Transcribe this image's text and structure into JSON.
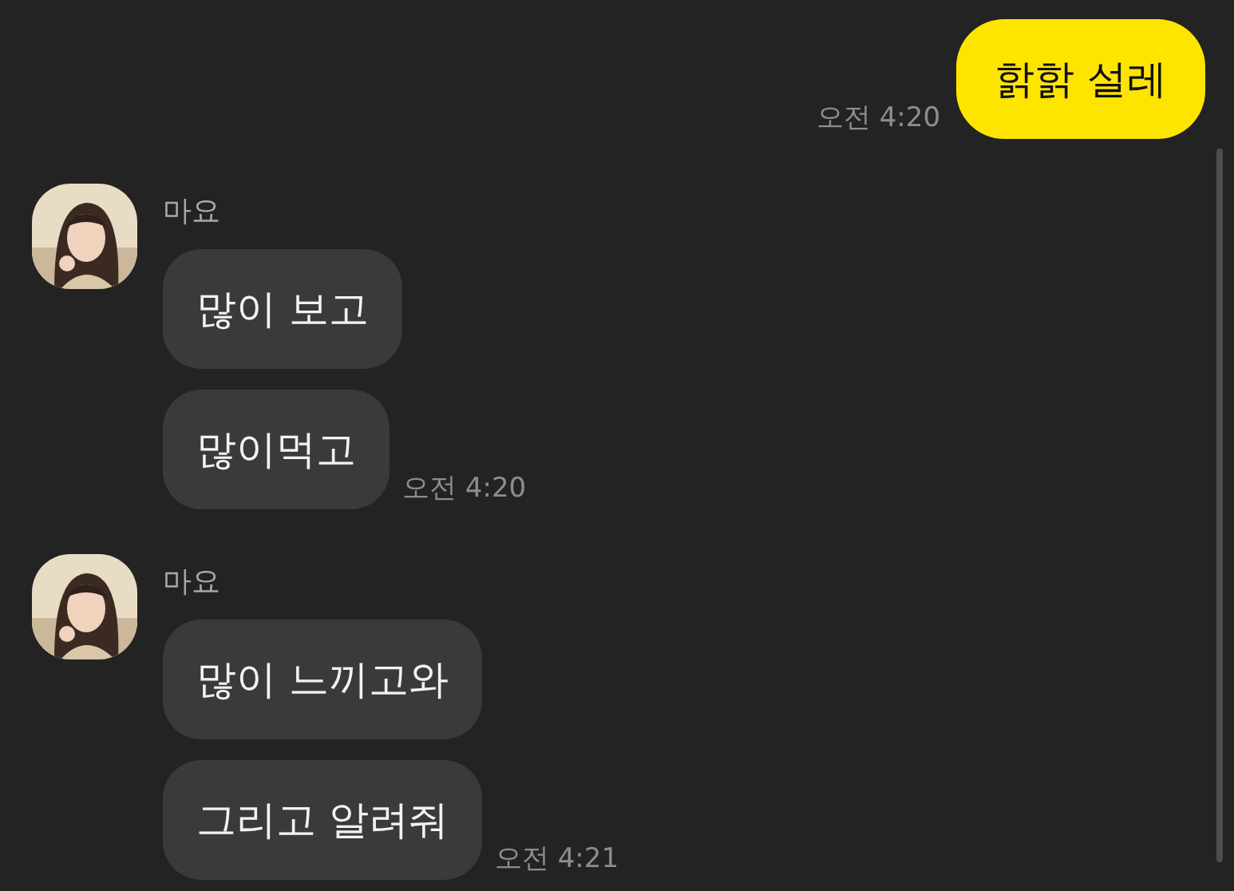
{
  "messages": [
    {
      "kind": "sent",
      "bubbles": [
        "핡핡 설레"
      ],
      "time": "오전 4:20"
    },
    {
      "kind": "received",
      "sender": "마요",
      "avatar": {
        "kind": "picture"
      },
      "bubbles": [
        "많이 보고",
        "많이먹고"
      ],
      "time": "오전 4:20"
    },
    {
      "kind": "received",
      "sender": "마요",
      "avatar": {
        "kind": "picture"
      },
      "bubbles": [
        "많이 느끼고와",
        "그리고 알려줘"
      ],
      "time": "오전 4:21"
    }
  ]
}
